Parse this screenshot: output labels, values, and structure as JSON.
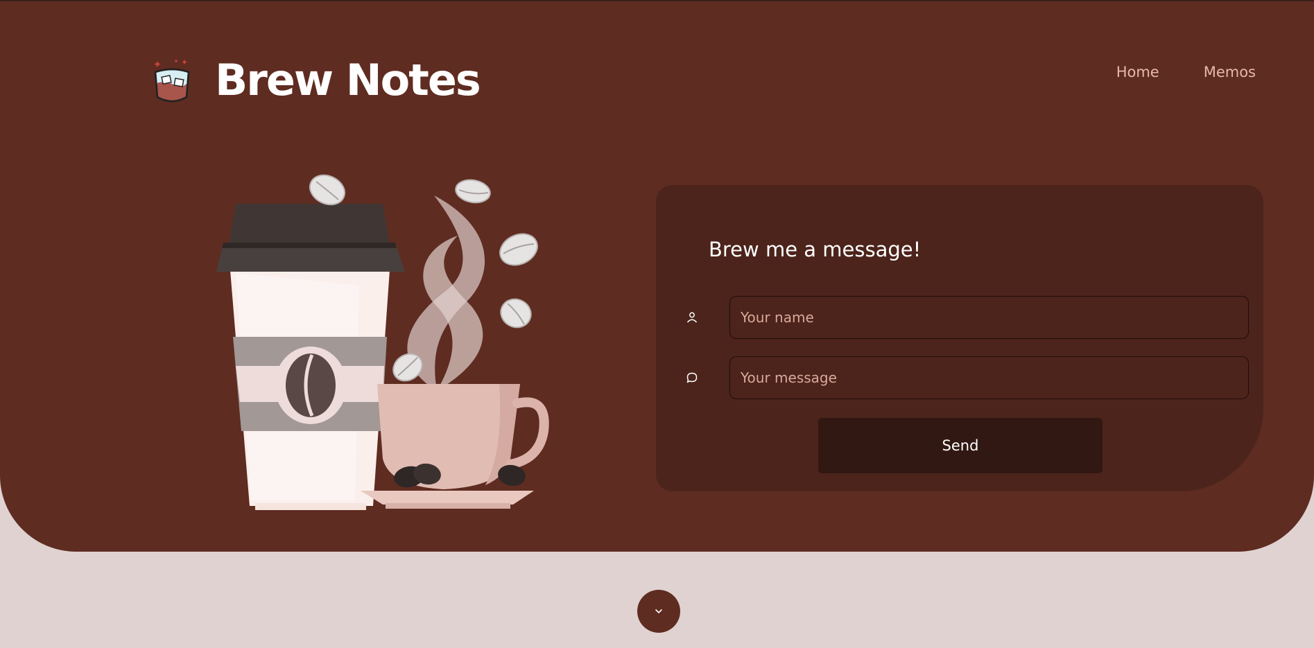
{
  "brand": {
    "title": "Brew Notes",
    "logo_icon": "iced-coffee-glass-icon"
  },
  "nav": {
    "items": [
      {
        "label": "Home"
      },
      {
        "label": "Memos"
      }
    ]
  },
  "form": {
    "title": "Brew me a message!",
    "name_placeholder": "Your name",
    "message_placeholder": "Your message",
    "name_icon": "user-icon",
    "message_icon": "chat-bubble-icon",
    "send_label": "Send"
  },
  "scroll_icon": "chevron-down-icon",
  "colors": {
    "hero_bg": "#5f2c21",
    "card_bg": "#4c241b",
    "button_bg": "#311812",
    "page_bg": "#dfd2d1",
    "nav_text": "#e6b9ad"
  }
}
